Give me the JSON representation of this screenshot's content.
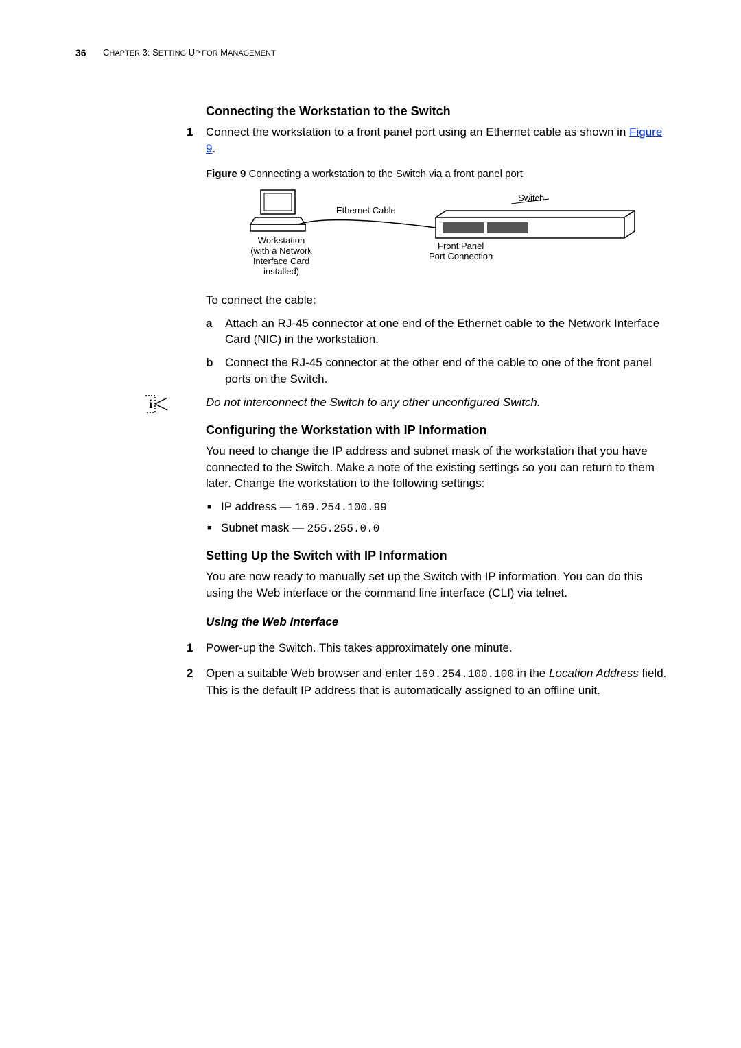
{
  "page_number": "36",
  "chapter_label": "Chapter 3: Setting Up for Management",
  "sect1_title": "Connecting the Workstation to the Switch",
  "step1_num": "1",
  "step1a": "Connect the workstation to a front panel port using an Ethernet cable as shown in ",
  "step1_link": "Figure 9",
  "step1b": ".",
  "fig_caption_bold": "Figure 9",
  "fig_caption": "   Connecting a workstation to the Switch via a front panel port",
  "diagram": {
    "workstation": "Workstation\n(with a Network\nInterface Card\ninstalled)",
    "eth": "Ethernet Cable",
    "switch": "Switch",
    "port": "Front Panel\nPort Connection"
  },
  "connect_intro": "To connect the cable:",
  "sub_a_num": "a",
  "sub_a": "Attach an RJ-45 connector at one end of the Ethernet cable to the Network Interface Card (NIC) in the workstation.",
  "sub_b_num": "b",
  "sub_b": "Connect the RJ-45 connector at the other end of the cable to one of the front panel ports on the Switch.",
  "info_note": "Do not interconnect the Switch to any other unconfigured Switch.",
  "sect2_title": "Configuring the Workstation with IP Information",
  "sect2_p1": "You need to change the IP address and subnet mask of the workstation that you have connected to the Switch. Make a note of the existing settings so you can return to them later. Change the workstation to the following settings:",
  "ip_label": "IP address — ",
  "ip_value": "169.254.100.99",
  "mask_label": "Subnet mask — ",
  "mask_value": "255.255.0.0",
  "sect3_title": "Setting Up the Switch with IP Information",
  "sect3_p1": "You are now ready to manually set up the Switch with IP information. You can do this using the Web interface or the command line interface (CLI) via telnet.",
  "subsect_title": "Using the Web Interface",
  "web1_num": "1",
  "web1": "Power-up the Switch. This takes approximately one minute.",
  "web2_num": "2",
  "web2a": "Open a suitable Web browser and enter ",
  "web2_mono": "169.254.100.100",
  "web2b": " in the ",
  "web2_italic": "Location Address",
  "web2c": " field. This is the default IP address that is automatically assigned to an offline unit."
}
